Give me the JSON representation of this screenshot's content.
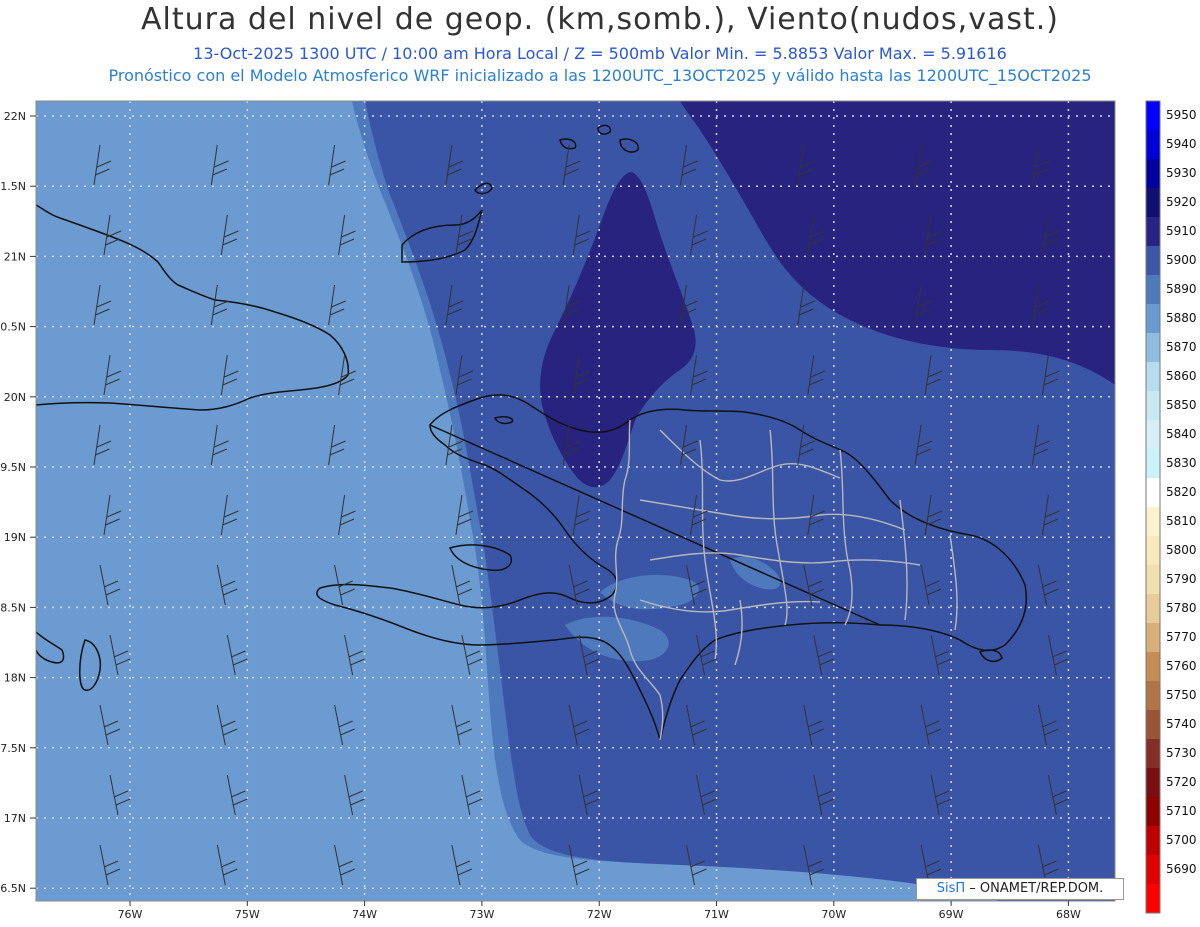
{
  "header": {
    "title": "Altura del nivel de geop. (km,somb.), Viento(nudos,vast.)",
    "line1": "13-Oct-2025  1300 UTC / 10:00 am Hora Local / Z = 500mb    Valor Min. = 5.8853  Valor Max. = 5.91616",
    "line2": "Pronóstico con el Modelo Atmosferico WRF inicializado a las 1200UTC_13OCT2025 y válido hasta las  1200UTC_15OCT2025"
  },
  "map": {
    "lat_labels": [
      "22N",
      "1.5N",
      "21N",
      "0.5N",
      "20N",
      "9.5N",
      "19N",
      "8.5N",
      "18N",
      "7.5N",
      "17N",
      "6.5N"
    ],
    "lon_labels": [
      "76W",
      "75W",
      "74W",
      "73W",
      "72W",
      "71W",
      "70W",
      "69W",
      "68W"
    ],
    "colors": {
      "level_5880": "#6b9bd0",
      "level_5890": "#4f79bd",
      "level_5900": "#3a55a6",
      "level_5910": "#28237f",
      "coastline": "#111111",
      "borders": "#b8b8b8",
      "grid": "#d7dbe7"
    }
  },
  "colorbar": {
    "levels": [
      "5950",
      "5940",
      "5930",
      "5920",
      "5910",
      "5900",
      "5890",
      "5880",
      "5870",
      "5860",
      "5850",
      "5840",
      "5830",
      "5820",
      "5810",
      "5800",
      "5790",
      "5780",
      "5770",
      "5760",
      "5750",
      "5740",
      "5730",
      "5720",
      "5710",
      "5700",
      "5690"
    ],
    "colors": [
      "#0000ff",
      "#0000d8",
      "#00009e",
      "#101070",
      "#272484",
      "#3e56a8",
      "#4f79bd",
      "#6a9bd0",
      "#8fbde0",
      "#b5dcef",
      "#c6e9f2",
      "#d6eef6",
      "#c9f3f8",
      "#ffffff",
      "#fbf3cf",
      "#f6e9bb",
      "#f1dfae",
      "#e8cd9a",
      "#d7af78",
      "#c48d55",
      "#b07446",
      "#9c5336",
      "#872d27",
      "#7a0f12",
      "#8f0000",
      "#c00000",
      "#e00000",
      "#ff0000"
    ]
  },
  "credit": {
    "sis": "SisΠ",
    "rest": "– ONAMET/REP.DOM."
  }
}
